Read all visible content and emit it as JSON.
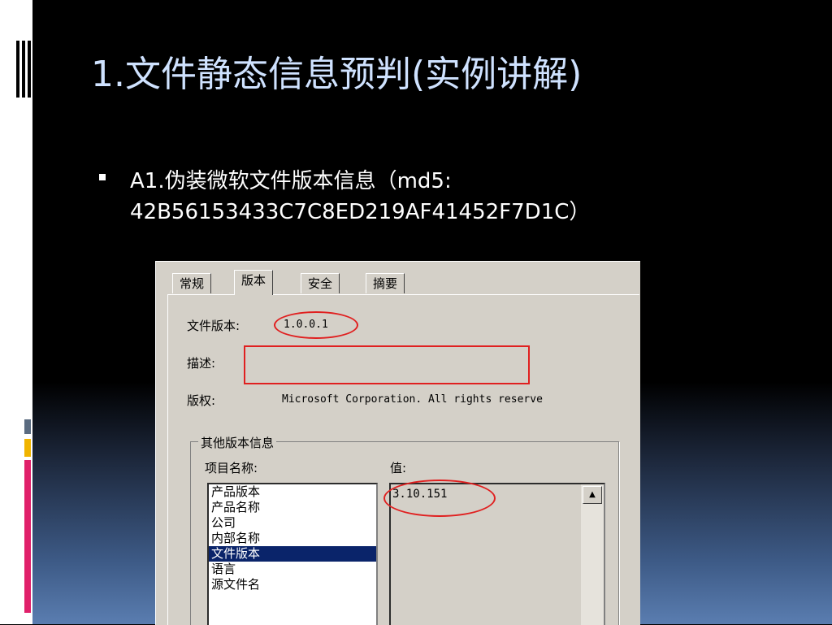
{
  "slide": {
    "title": "1.文件静态信息预判(实例讲解)",
    "bullet": "A1.伪装微软文件版本信息（md5: 42B56153433C7C8ED219AF41452F7D1C）"
  },
  "dialog": {
    "tabs": [
      "常规",
      "版本",
      "安全",
      "摘要"
    ],
    "active_tab": "版本",
    "file_version_label": "文件版本:",
    "file_version_value": "1.0.0.1",
    "description_label": "描述:",
    "description_value": "",
    "copyright_label": "版权:",
    "copyright_value": "Microsoft Corporation. All rights reserve",
    "group_title": "其他版本信息",
    "item_name_label": "项目名称:",
    "value_label": "值:",
    "items": [
      "产品版本",
      "产品名称",
      "公司",
      "内部名称",
      "文件版本",
      "语言",
      "源文件名"
    ],
    "selected_item": "文件版本",
    "selected_value": "3.10.151"
  },
  "colors": {
    "title": "#cfe2ff",
    "highlight_red": "#e02020",
    "selection_blue": "#0a246a",
    "accent_yellow": "#f0b400",
    "accent_pink": "#e0206a"
  }
}
